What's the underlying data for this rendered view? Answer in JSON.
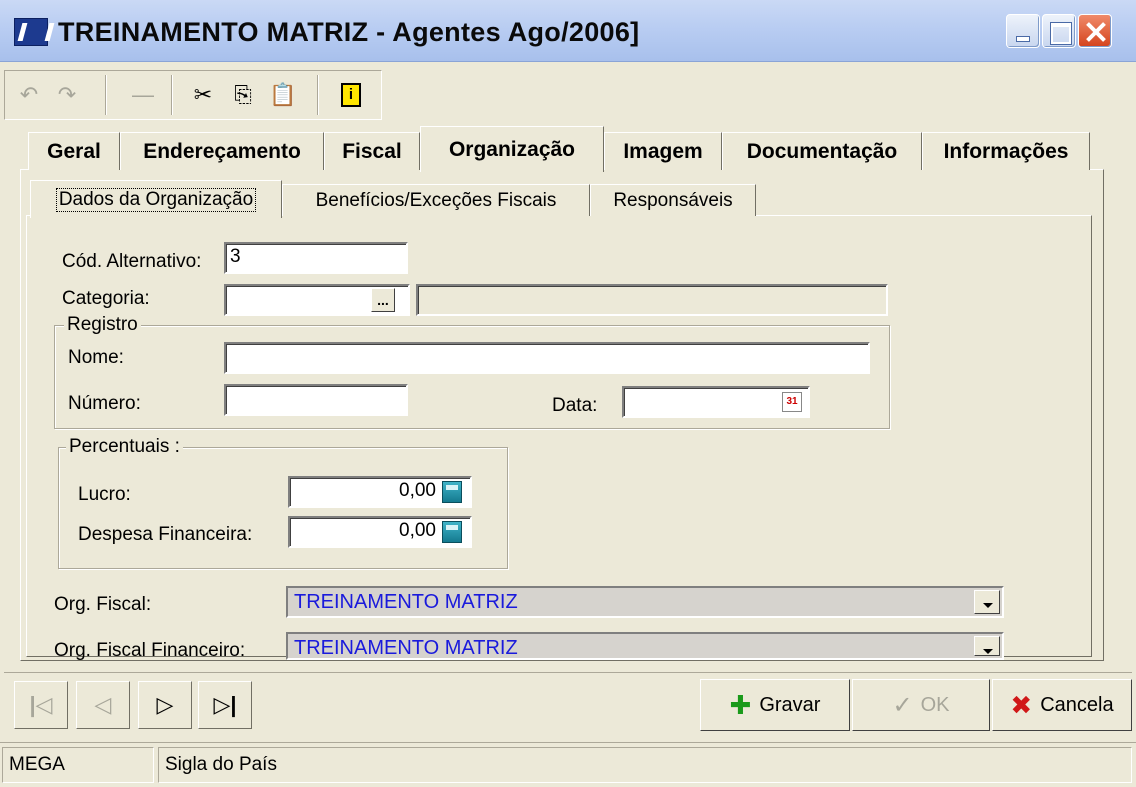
{
  "window": {
    "title": "TREINAMENTO MATRIZ -  Agentes Ago/2006]"
  },
  "toolbar": {
    "icons": [
      "undo-icon",
      "redo-icon",
      "minus-icon",
      "cut-icon",
      "copy-icon",
      "paste-icon",
      "info-icon"
    ]
  },
  "tabs": [
    {
      "label": "Geral"
    },
    {
      "label": "Endereçamento"
    },
    {
      "label": "Fiscal"
    },
    {
      "label": "Organização"
    },
    {
      "label": "Imagem"
    },
    {
      "label": "Documentação"
    },
    {
      "label": "Informações"
    }
  ],
  "active_tab": "Organização",
  "subtabs": [
    {
      "label": "Dados da Organização"
    },
    {
      "label": "Benefícios/Exceções Fiscais"
    },
    {
      "label": "Responsáveis"
    }
  ],
  "form": {
    "cod_alternativo_label": "Cód. Alternativo:",
    "cod_alternativo_value": "3",
    "categoria_label": "Categoria:",
    "categoria_value": "",
    "categoria_btn": "...",
    "registro": {
      "title": "Registro",
      "nome_label": "Nome:",
      "nome_value": "",
      "numero_label": "Número:",
      "numero_value": "",
      "data_label": "Data:",
      "data_value": ""
    },
    "percentuais": {
      "title": "Percentuais :",
      "lucro_label": "Lucro:",
      "lucro_value": "0,00",
      "despesa_label": "Despesa Financeira:",
      "despesa_value": "0,00"
    },
    "org_fiscal_label": "Org. Fiscal:",
    "org_fiscal_value": "TREINAMENTO MATRIZ",
    "org_fiscal_fin_label": "Org. Fiscal Financeiro:",
    "org_fiscal_fin_value": "TREINAMENTO MATRIZ"
  },
  "actions": {
    "gravar": "Gravar",
    "ok": "OK",
    "cancela": "Cancela"
  },
  "status": {
    "user": "MEGA",
    "hint": "Sigla do País"
  },
  "colors": {
    "combo_text": "#1a1adc",
    "gravar_icon": "#1a9a1a",
    "cancela_icon": "#d01818"
  }
}
